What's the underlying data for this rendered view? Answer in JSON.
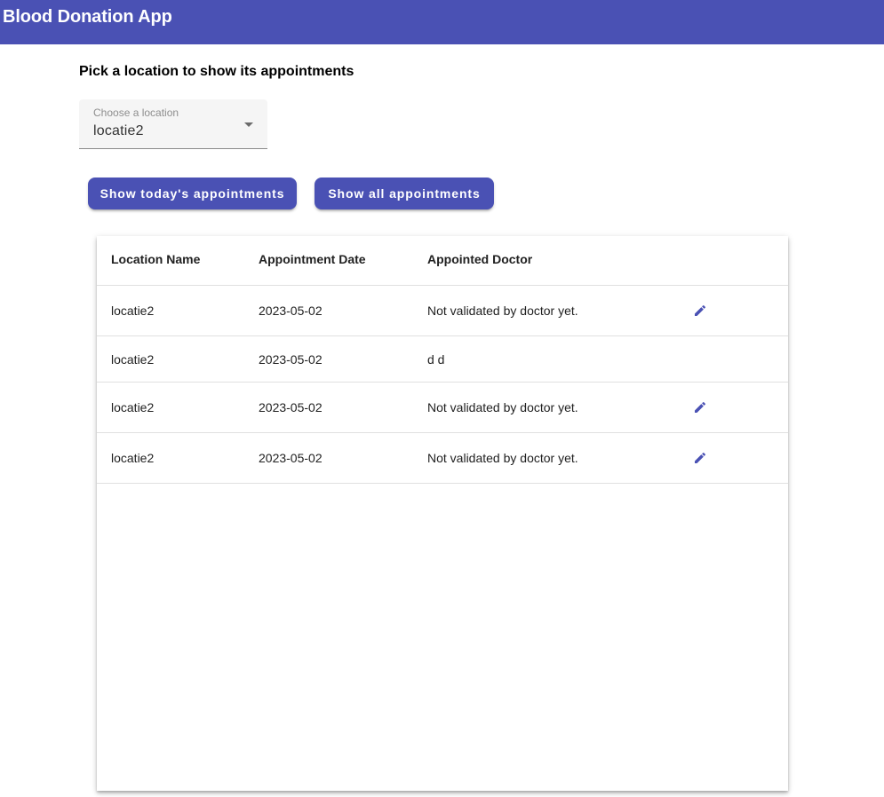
{
  "app": {
    "title": "Blood Donation App"
  },
  "page": {
    "heading": "Pick a location to show its appointments"
  },
  "location_select": {
    "label": "Choose a location",
    "value": "locatie2"
  },
  "buttons": {
    "today": "Show today's appointments",
    "all": "Show all appointments"
  },
  "table": {
    "columns": [
      "Location Name",
      "Appointment Date",
      "Appointed Doctor"
    ],
    "rows": [
      {
        "location": "locatie2",
        "date": "2023-05-02",
        "doctor": "Not validated by doctor yet.",
        "editable": true
      },
      {
        "location": "locatie2",
        "date": "2023-05-02",
        "doctor": "d d",
        "editable": false
      },
      {
        "location": "locatie2",
        "date": "2023-05-02",
        "doctor": "Not validated by doctor yet.",
        "editable": true
      },
      {
        "location": "locatie2",
        "date": "2023-05-02",
        "doctor": "Not validated by doctor yet.",
        "editable": true
      }
    ]
  },
  "icons": {
    "edit": "edit-pencil-icon",
    "dropdown": "arrow-drop-down-icon"
  },
  "colors": {
    "primary": "#4a51b4",
    "surface": "#ffffff",
    "field_background": "#f5f5f5"
  }
}
